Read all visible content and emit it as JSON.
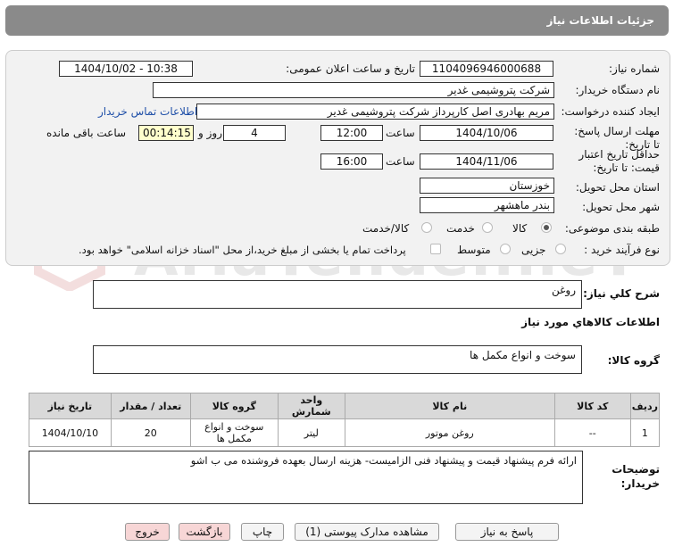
{
  "header": {
    "title": "جزئیات اطلاعات نیاز"
  },
  "watermark": {
    "text": "AriaTender.neT"
  },
  "form": {
    "need_number": {
      "label": "شماره نیاز:",
      "value": "1104096946000688"
    },
    "announce": {
      "label": "تاریخ و ساعت اعلان عمومی:",
      "value": "1404/10/02 - 10:38"
    },
    "buyer_org": {
      "label": "نام دستگاه خریدار:",
      "value": "شرکت پتروشیمی غدیر"
    },
    "requester": {
      "label": "ایجاد کننده درخواست:",
      "value": "مریم بهادری اصل کارپرداز شرکت پتروشیمی غدیر",
      "contact_link": "اطلاعات تماس خریدار"
    },
    "deadline": {
      "label": "مهلت ارسال پاسخ: تا تاریخ:",
      "date": "1404/10/06",
      "time_label": "ساعت",
      "time": "12:00",
      "days": "4",
      "days_label": "روز و",
      "remaining": "00:14:15",
      "remaining_label": "ساعت باقی مانده"
    },
    "validity": {
      "label": "حداقل تاریخ اعتبار قیمت: تا تاریخ:",
      "date": "1404/11/06",
      "time_label": "ساعت",
      "time": "16:00"
    },
    "province": {
      "label": "استان محل تحویل:",
      "value": "خوزستان"
    },
    "city": {
      "label": "شهر محل تحویل:",
      "value": "بندر ماهشهر"
    },
    "category": {
      "label": "طبقه بندی موضوعی:",
      "options": [
        "کالا",
        "خدمت",
        "کالا/خدمت"
      ],
      "selected": 0
    },
    "process": {
      "label": "نوع فرآیند خرید :",
      "options": [
        "جزیی",
        "متوسط"
      ],
      "selected": -1,
      "note": "پرداخت تمام یا بخشی از مبلغ خرید،از محل \"اسناد خزانه اسلامی\" خواهد بود."
    }
  },
  "summary": {
    "label": "شرح کلي نياز:",
    "value": "روغن"
  },
  "goods_info": {
    "title": "اطلاعات کالاهاي مورد نياز"
  },
  "goods_group": {
    "label": "گروه کالا:",
    "value": "سوخت و انواع مکمل ها"
  },
  "table": {
    "headers": [
      "ردیف",
      "کد کالا",
      "نام کالا",
      "واحد شمارش",
      "گروه کالا",
      "تعداد / مقدار",
      "تاریخ نیاز"
    ],
    "rows": [
      [
        "1",
        "--",
        "روغن موتور",
        "لیتر",
        "سوخت و انواع مکمل ها",
        "20",
        "1404/10/10"
      ]
    ]
  },
  "buyer_notes": {
    "label": "توضیحات خریدار:",
    "value": "ارائه فرم پیشنهاد قیمت و پیشنهاد فنی الزامیست- هزینه ارسال بعهده فروشنده می ب اشو"
  },
  "buttons": {
    "reply": "پاسخ به نياز",
    "attachments": "مشاهده مدارک پیوستی (1)",
    "print": "چاپ",
    "back": "بازگشت",
    "exit": "خروج"
  }
}
